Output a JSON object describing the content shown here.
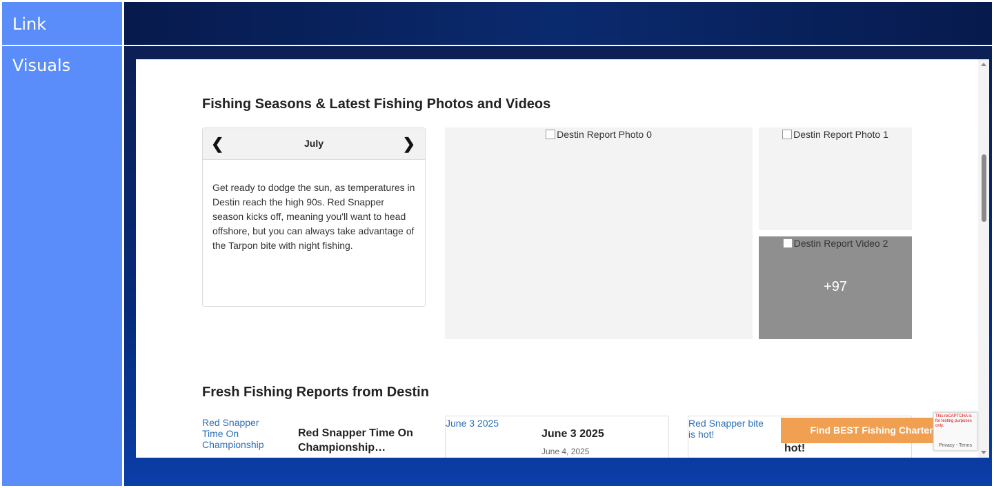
{
  "labels": {
    "link": "Link",
    "visuals": "Visuals"
  },
  "colors": {
    "label_bg": "#5a8dfa",
    "panel_bg": "#062a7a",
    "cta_bg": "#f0a050"
  },
  "seasons": {
    "heading": "Fishing Seasons & Latest Fishing Photos and Videos",
    "month": "July",
    "prev_icon": "chevron-left-icon",
    "next_icon": "chevron-right-icon",
    "description": "Get ready to dodge the sun, as temperatures in Destin reach the high 90s. Red Snapper season kicks off, meaning you'll want to head offshore, but you can always take advantage of the Tarpon bite with night fishing."
  },
  "gallery": {
    "photo_0_alt": "Destin Report Photo 0",
    "photo_1_alt": "Destin Report Photo 1",
    "video_2_alt": "Destin Report Video 2",
    "more_count": "+97"
  },
  "reports": {
    "heading": "Fresh Fishing Reports from Destin",
    "items": [
      {
        "img_alt": "Red Snapper Time On Championship",
        "title": "Red Snapper Time On Championship…",
        "date": ""
      },
      {
        "img_alt": "June 3 2025",
        "title": "June 3 2025",
        "date": "June 4, 2025"
      },
      {
        "img_alt": "Red Snapper bite is hot!",
        "title": "hot!",
        "date": ""
      }
    ]
  },
  "cta": {
    "label": "Find BEST Fishing Charters"
  },
  "recaptcha": {
    "warning": "This reCAPTCHA is for testing purposes only.",
    "terms": "Privacy - Terms"
  }
}
